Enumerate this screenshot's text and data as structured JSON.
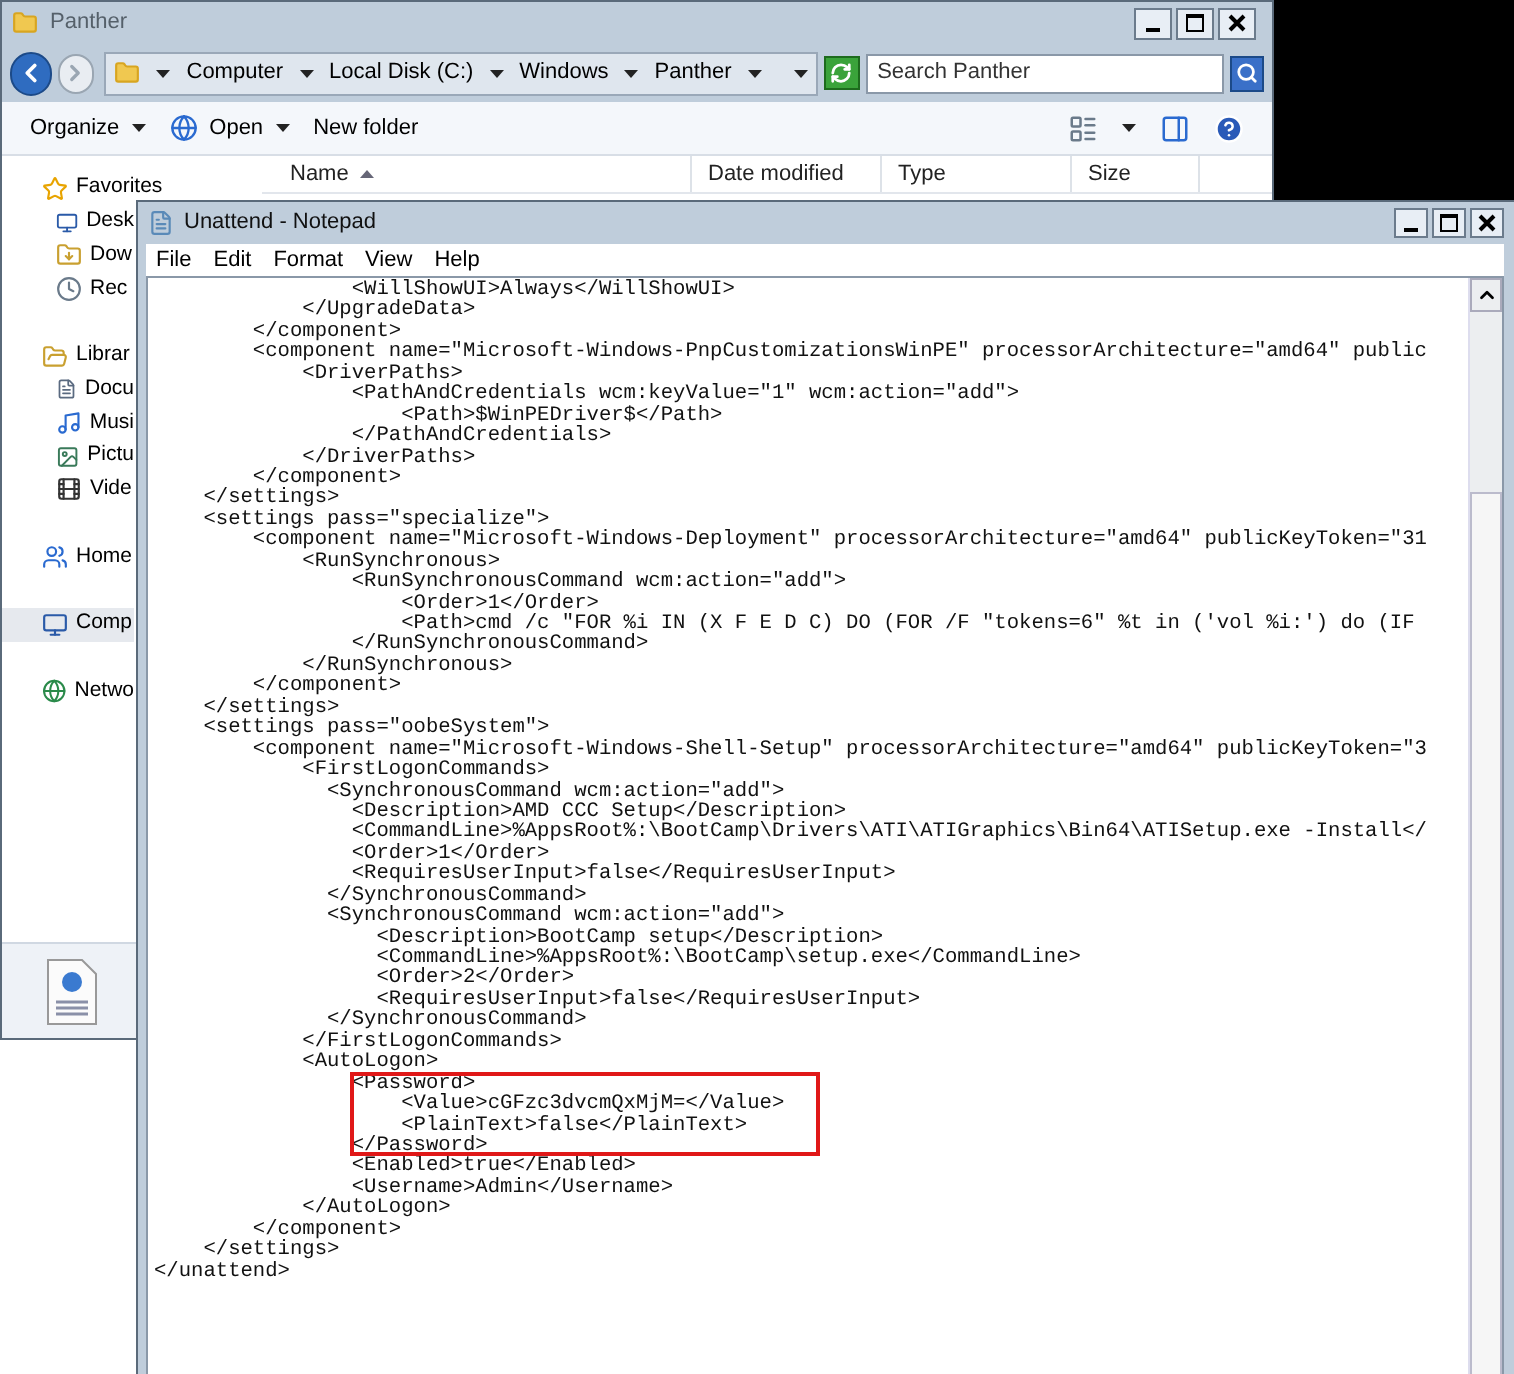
{
  "explorer": {
    "title": "Panther",
    "breadcrumbs": [
      "Computer",
      "Local Disk (C:)",
      "Windows",
      "Panther"
    ],
    "search": {
      "placeholder": "Search Panther"
    },
    "toolbar": [
      {
        "label": "Organize",
        "kind": "menu"
      },
      {
        "label": "Open",
        "kind": "app"
      },
      {
        "label": "New folder",
        "kind": "plain"
      }
    ],
    "columns": [
      {
        "label": "Name",
        "sorted": true
      },
      {
        "label": "Date modified",
        "sorted": false
      },
      {
        "label": "Type",
        "sorted": false
      },
      {
        "label": "Size",
        "sorted": false
      }
    ],
    "sidebar": [
      {
        "label": "Favorites",
        "kind": "favorites",
        "selected": false,
        "children": [
          {
            "label": "Desk",
            "kind": "desktop",
            "selected": false
          },
          {
            "label": "Dow",
            "kind": "downloads",
            "selected": false
          },
          {
            "label": "Rec",
            "kind": "recent",
            "selected": false
          }
        ]
      },
      {
        "label": "Librar",
        "kind": "libraries",
        "selected": false,
        "children": [
          {
            "label": "Docu",
            "kind": "documents",
            "selected": false
          },
          {
            "label": "Musi",
            "kind": "music",
            "selected": false
          },
          {
            "label": "Pictu",
            "kind": "pictures",
            "selected": false
          },
          {
            "label": "Vide",
            "kind": "videos",
            "selected": false
          }
        ]
      },
      {
        "label": "Home",
        "kind": "homegroup",
        "selected": false
      },
      {
        "label": "Comp",
        "kind": "computer",
        "selected": true
      },
      {
        "label": "Netwo",
        "kind": "network",
        "selected": false
      }
    ]
  },
  "notepad": {
    "title": "Unattend - Notepad",
    "menu": [
      "File",
      "Edit",
      "Format",
      "View",
      "Help"
    ],
    "lines_before": [
      "                <WillShowUI>Always</WillShowUI>",
      "            </UpgradeData>",
      "        </component>",
      "        <component name=\"Microsoft-Windows-PnpCustomizationsWinPE\" processorArchitecture=\"amd64\" public",
      "            <DriverPaths>",
      "                <PathAndCredentials wcm:keyValue=\"1\" wcm:action=\"add\">",
      "                    <Path>$WinPEDriver$</Path>",
      "                </PathAndCredentials>",
      "            </DriverPaths>",
      "        </component>",
      "    </settings>",
      "    <settings pass=\"specialize\">",
      "        <component name=\"Microsoft-Windows-Deployment\" processorArchitecture=\"amd64\" publicKeyToken=\"31",
      "            <RunSynchronous>",
      "                <RunSynchronousCommand wcm:action=\"add\">",
      "                    <Order>1</Order>",
      "                    <Path>cmd /c \"FOR %i IN (X F E D C) DO (FOR /F \"tokens=6\" %t in ('vol %i:') do (IF",
      "                </RunSynchronousCommand>",
      "            </RunSynchronous>",
      "        </component>",
      "    </settings>",
      "    <settings pass=\"oobeSystem\">",
      "        <component name=\"Microsoft-Windows-Shell-Setup\" processorArchitecture=\"amd64\" publicKeyToken=\"3",
      "            <FirstLogonCommands>",
      "              <SynchronousCommand wcm:action=\"add\">",
      "                <Description>AMD CCC Setup</Description>",
      "                <CommandLine>%AppsRoot%:\\BootCamp\\Drivers\\ATI\\ATIGraphics\\Bin64\\ATISetup.exe -Install</",
      "                <Order>1</Order>",
      "                <RequiresUserInput>false</RequiresUserInput>",
      "              </SynchronousCommand>",
      "              <SynchronousCommand wcm:action=\"add\">",
      "                  <Description>BootCamp setup</Description>",
      "                  <CommandLine>%AppsRoot%:\\BootCamp\\setup.exe</CommandLine>",
      "                  <Order>2</Order>",
      "                  <RequiresUserInput>false</RequiresUserInput>",
      "              </SynchronousCommand>",
      "            </FirstLogonCommands>",
      "            <AutoLogon>"
    ],
    "highlighted_lines": [
      "                <Password>",
      "                    <Value>cGFzc3dvcmQxMjM=</Value>",
      "                    <PlainText>false</PlainText>",
      "                </Password>"
    ],
    "lines_after": [
      "                <Enabled>true</Enabled>",
      "                <Username>Admin</Username>",
      "            </AutoLogon>",
      "        </component>",
      "    </settings>",
      "</unattend>"
    ]
  }
}
